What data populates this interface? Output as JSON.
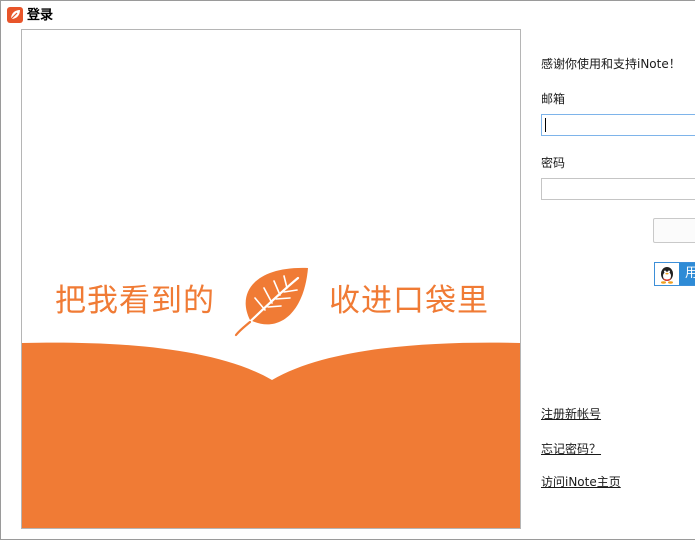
{
  "window": {
    "title": "登录"
  },
  "banner": {
    "slogan_left": "把我看到的",
    "slogan_right": "收进口袋里",
    "brand_color": "#f07b35"
  },
  "form": {
    "welcome": "感谢你使用和支持iNote！",
    "email_label": "邮箱",
    "email_value": "",
    "password_label": "密码",
    "password_value": "",
    "qq_login_label": "用"
  },
  "links": {
    "register": "注册新帐号",
    "forgot_password": "忘记密码？",
    "homepage": "访问iNote主页"
  },
  "icons": {
    "app": "inote-leaf-icon",
    "banner": "leaf-icon",
    "qq": "qq-penguin-icon"
  },
  "colors": {
    "accent": "#f07b35",
    "qq_blue": "#2e8bd6",
    "focus_border": "#7eb4ea"
  }
}
